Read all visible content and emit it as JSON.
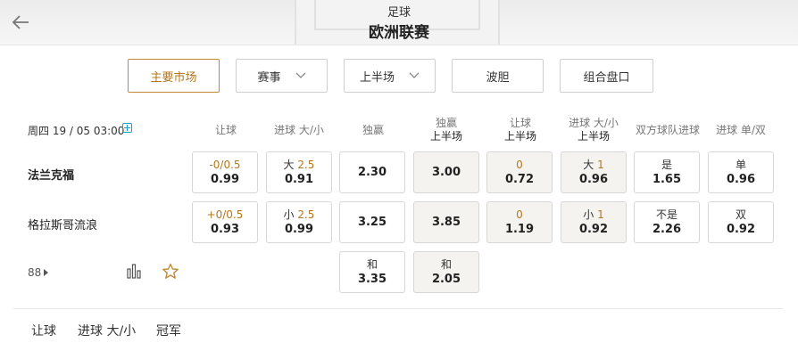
{
  "header": {
    "sport": "足球",
    "league": "欧洲联赛"
  },
  "filters": [
    {
      "label": "主要市场",
      "active": true,
      "dropdown": false
    },
    {
      "label": "赛事",
      "active": false,
      "dropdown": true
    },
    {
      "label": "上半场",
      "active": false,
      "dropdown": true
    },
    {
      "label": "波胆",
      "active": false,
      "dropdown": false
    },
    {
      "label": "组合盘口",
      "active": false,
      "dropdown": false
    }
  ],
  "match": {
    "datetime": "周四 19 / 05 03:00",
    "home": "法兰克福",
    "away": "格拉斯哥流浪",
    "more_count": "88"
  },
  "columns": [
    {
      "top": "让球",
      "sub": ""
    },
    {
      "top": "进球 大/小",
      "sub": ""
    },
    {
      "top": "独赢",
      "sub": ""
    },
    {
      "top": "独赢",
      "sub": "上半场"
    },
    {
      "top": "让球",
      "sub": "上半场"
    },
    {
      "top": "进球 大/小",
      "sub": "上半场"
    },
    {
      "top": "双方球队进球",
      "sub": ""
    },
    {
      "top": "进球 单/双",
      "sub": ""
    }
  ],
  "home_row": [
    {
      "line": "-0/0.5",
      "prefix": "",
      "odds": "0.99"
    },
    {
      "line": "2.5",
      "prefix": "大 ",
      "odds": "0.91"
    },
    {
      "line": "",
      "prefix": "",
      "odds": "2.30"
    },
    {
      "line": "",
      "prefix": "",
      "odds": "3.00"
    },
    {
      "line": "0",
      "prefix": "",
      "odds": "0.72"
    },
    {
      "line": "1",
      "prefix": "大 ",
      "odds": "0.96"
    },
    {
      "line": "",
      "prefix": "是",
      "odds": "1.65"
    },
    {
      "line": "",
      "prefix": "单",
      "odds": "0.96"
    }
  ],
  "away_row": [
    {
      "line": "+0/0.5",
      "prefix": "",
      "odds": "0.93"
    },
    {
      "line": "2.5",
      "prefix": "小 ",
      "odds": "0.99"
    },
    {
      "line": "",
      "prefix": "",
      "odds": "3.25"
    },
    {
      "line": "",
      "prefix": "",
      "odds": "3.85"
    },
    {
      "line": "0",
      "prefix": "",
      "odds": "1.19"
    },
    {
      "line": "1",
      "prefix": "小 ",
      "odds": "0.92"
    },
    {
      "line": "",
      "prefix": "不是",
      "odds": "2.26"
    },
    {
      "line": "",
      "prefix": "双",
      "odds": "0.92"
    }
  ],
  "draw_row": [
    {
      "label": "和",
      "odds": "3.35"
    },
    {
      "label": "和",
      "odds": "2.05"
    }
  ],
  "bottom_tabs": [
    "让球",
    "进球 大/小",
    "冠军"
  ],
  "colors": {
    "accent": "#b3761f",
    "shaded_cell": "#f5f3ef",
    "live_icon": "#1aa0c8"
  },
  "icons": [
    "back-arrow-icon",
    "chevron-down-icon",
    "live-plus-icon",
    "stats-bar-icon",
    "star-icon"
  ]
}
